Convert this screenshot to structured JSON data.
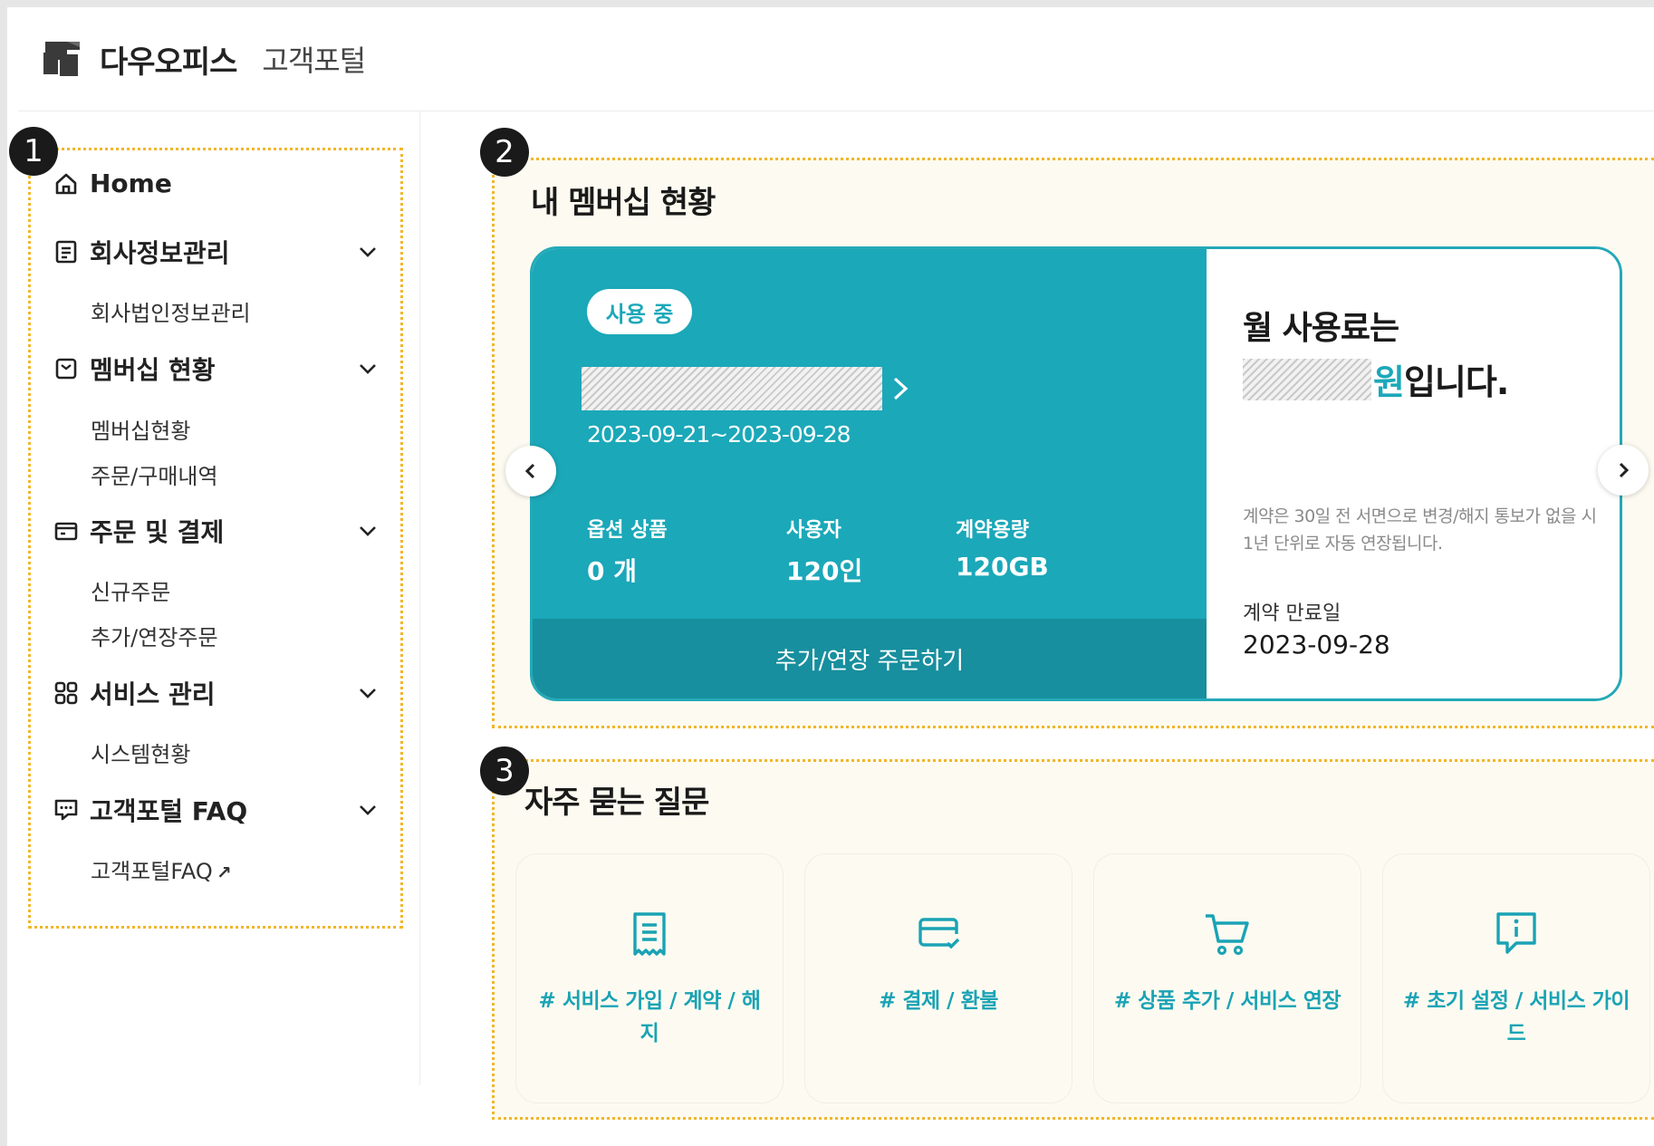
{
  "header": {
    "brand": "다우오피스",
    "portal": "고객포털"
  },
  "markers": [
    "1",
    "2",
    "3"
  ],
  "sidebar": {
    "home": "Home",
    "groups": [
      {
        "label": "회사정보관리",
        "icon": "document-list-icon",
        "subs": [
          "회사법인정보관리"
        ]
      },
      {
        "label": "멤버십 현황",
        "icon": "membership-box-icon",
        "subs": [
          "멤버십현황",
          "주문/구매내역"
        ]
      },
      {
        "label": "주문 및 결제",
        "icon": "payment-card-icon",
        "subs": [
          "신규주문",
          "추가/연장주문"
        ]
      },
      {
        "label": "서비스 관리",
        "icon": "grid-apps-icon",
        "subs": [
          "시스템현황"
        ]
      },
      {
        "label": "고객포털 FAQ",
        "icon": "chat-bubble-icon",
        "subs": [
          "고객포털FAQ"
        ]
      }
    ],
    "external_mark": "↗"
  },
  "membership": {
    "title": "내 멤버십 현황",
    "badge": "사용 중",
    "period": "2023-09-21~2023-09-28",
    "stats": [
      {
        "label": "옵션 상품",
        "value": "0 개"
      },
      {
        "label": "사용자",
        "value": "120인"
      },
      {
        "label": "계약용량",
        "value": "120GB"
      }
    ],
    "order_button": "추가/연장 주문하기",
    "fee_line1": "월 사용료는",
    "fee_won": "원",
    "fee_suffix": "입니다.",
    "notice": "계약은 30일 전 서면으로 변경/해지 통보가 없을 시 1년 단위로 자동 연장됩니다.",
    "expiry_label": "계약 만료일",
    "expiry_value": "2023-09-28"
  },
  "faq": {
    "title": "자주 묻는 질문",
    "items": [
      {
        "label": "# 서비스 가입 / 계약 / 해지",
        "icon": "receipt-icon"
      },
      {
        "label": "# 결제 / 환불",
        "icon": "credit-card-check-icon"
      },
      {
        "label": "# 상품 추가 / 서비스 연장",
        "icon": "shopping-cart-icon"
      },
      {
        "label": "# 초기 설정 / 서비스 가이드",
        "icon": "info-bubble-icon"
      }
    ]
  },
  "colors": {
    "accent": "#1ba8b9",
    "accent_dark": "#178f9e",
    "highlight_border": "#f2b62b",
    "section_bg": "#fdfbf1"
  }
}
